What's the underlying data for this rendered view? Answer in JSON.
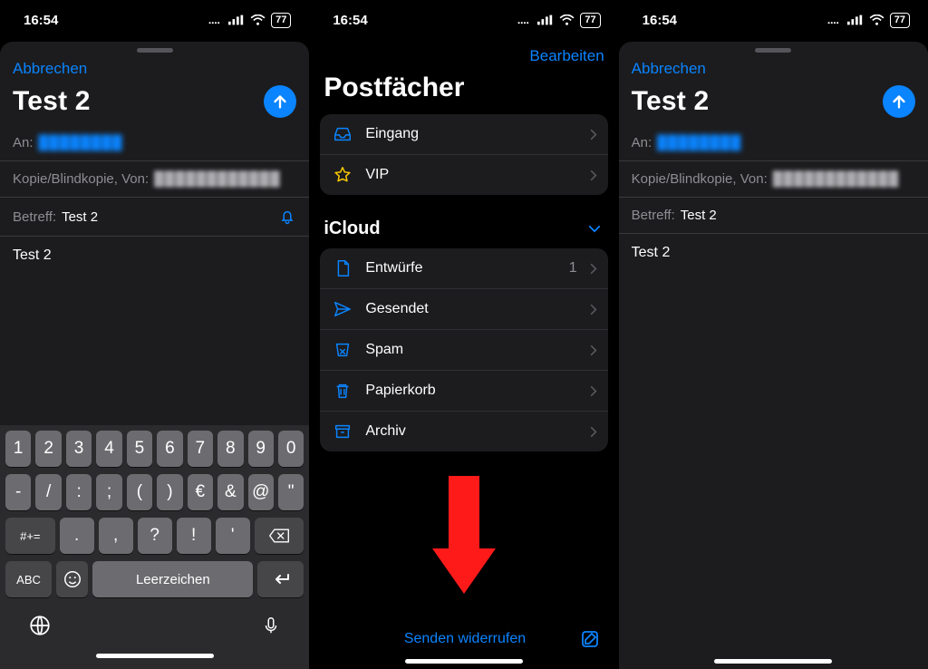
{
  "status": {
    "time": "16:54",
    "battery": "77"
  },
  "compose": {
    "cancel": "Abbrechen",
    "title": "Test 2",
    "to_label": "An:",
    "to_value": "████████",
    "cc_label": "Kopie/Blindkopie, Von:",
    "cc_value": "████████████",
    "subject_label": "Betreff:",
    "subject_value": "Test 2",
    "body": "Test 2"
  },
  "keyboard": {
    "row1": [
      "1",
      "2",
      "3",
      "4",
      "5",
      "6",
      "7",
      "8",
      "9",
      "0"
    ],
    "row2": [
      "-",
      "/",
      ":",
      ";",
      "(",
      ")",
      "€",
      "&",
      "@",
      "\""
    ],
    "row3_mode": "#+=",
    "row3": [
      ".",
      ",",
      "?",
      "!",
      "'"
    ],
    "row4_mode": "ABC",
    "space": "Leerzeichen"
  },
  "mailboxes": {
    "edit": "Bearbeiten",
    "title": "Postfächer",
    "top": [
      {
        "icon": "inbox",
        "label": "Eingang"
      },
      {
        "icon": "star",
        "label": "VIP"
      }
    ],
    "account_title": "iCloud",
    "account_items": [
      {
        "icon": "doc",
        "label": "Entwürfe",
        "count": "1"
      },
      {
        "icon": "send",
        "label": "Gesendet"
      },
      {
        "icon": "spam",
        "label": "Spam"
      },
      {
        "icon": "trash",
        "label": "Papierkorb"
      },
      {
        "icon": "archive",
        "label": "Archiv"
      }
    ],
    "undo_send": "Senden widerrufen"
  }
}
